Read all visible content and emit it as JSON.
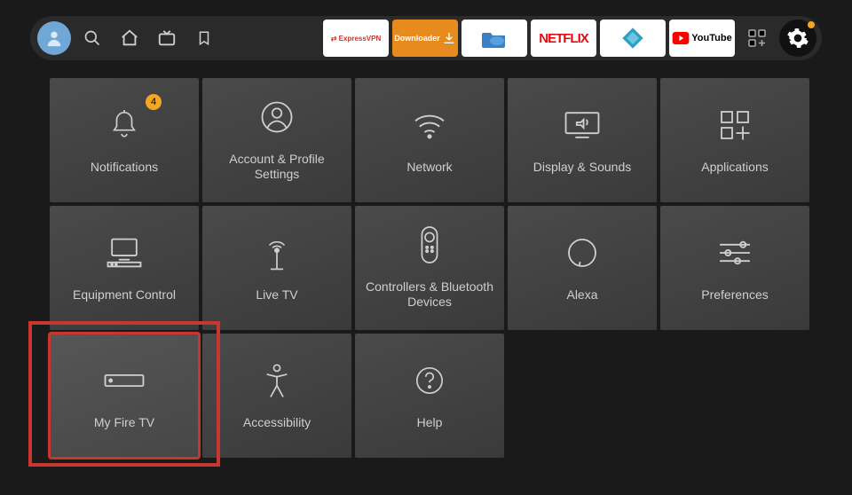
{
  "topbar": {
    "apps": [
      {
        "name": "expressvpn",
        "label": "ExpressVPN"
      },
      {
        "name": "downloader",
        "label": "Downloader"
      },
      {
        "name": "es-explorer",
        "label": "ES"
      },
      {
        "name": "netflix",
        "label": "NETFLIX"
      },
      {
        "name": "kodi",
        "label": "Kodi"
      },
      {
        "name": "youtube",
        "label": "YouTube"
      }
    ]
  },
  "notifications_badge": "4",
  "tiles": [
    {
      "label": "Notifications",
      "icon": "bell",
      "badge": true
    },
    {
      "label": "Account & Profile Settings",
      "icon": "user"
    },
    {
      "label": "Network",
      "icon": "wifi"
    },
    {
      "label": "Display & Sounds",
      "icon": "display"
    },
    {
      "label": "Applications",
      "icon": "apps"
    },
    {
      "label": "Equipment Control",
      "icon": "equipment"
    },
    {
      "label": "Live TV",
      "icon": "livetv"
    },
    {
      "label": "Controllers & Bluetooth Devices",
      "icon": "remote"
    },
    {
      "label": "Alexa",
      "icon": "alexa"
    },
    {
      "label": "Preferences",
      "icon": "prefs"
    },
    {
      "label": "My Fire TV",
      "icon": "firetv",
      "highlight": true
    },
    {
      "label": "Accessibility",
      "icon": "a11y"
    },
    {
      "label": "Help",
      "icon": "help"
    }
  ]
}
